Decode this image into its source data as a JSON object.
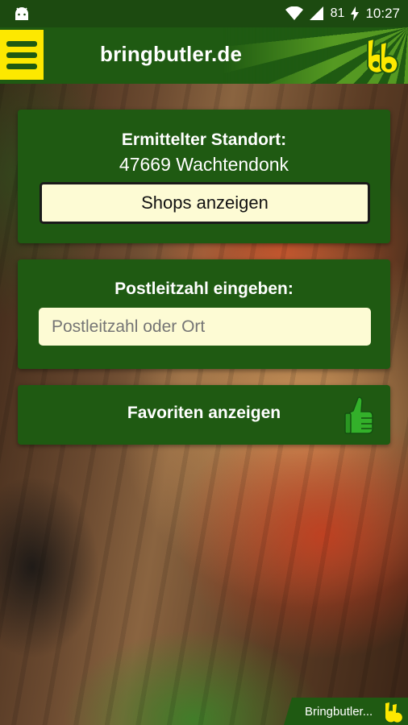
{
  "status_bar": {
    "battery": "81",
    "time": "10:27"
  },
  "app_bar": {
    "title": "bringbutler.de"
  },
  "location_card": {
    "heading": "Ermittelter Standort:",
    "location": "47669 Wachtendonk",
    "button_label": "Shops anzeigen"
  },
  "zip_card": {
    "heading": "Postleitzahl eingeben:",
    "input_placeholder": "Postleitzahl oder Ort",
    "input_value": ""
  },
  "favorites_card": {
    "label": "Favoriten anzeigen"
  },
  "bottom_tab": {
    "label": "Bringbutler..."
  },
  "colors": {
    "brand_green": "#1f5a12",
    "accent_yellow": "#fde800",
    "field_cream": "#fdfbd4"
  },
  "icons": {
    "menu": "hamburger-icon",
    "logo": "bringbutler-logo",
    "favorites": "thumbs-up-icon"
  }
}
